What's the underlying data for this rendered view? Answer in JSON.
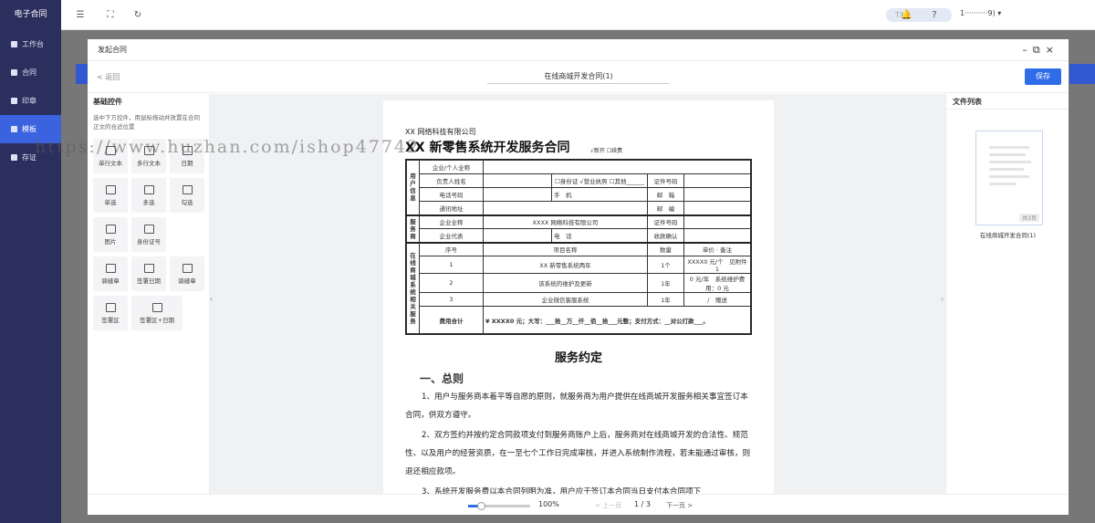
{
  "app": {
    "title": "电子合同"
  },
  "sidebar": {
    "items": [
      {
        "label": "工作台"
      },
      {
        "label": "合同"
      },
      {
        "label": "印章"
      },
      {
        "label": "模板"
      },
      {
        "label": "存证"
      }
    ]
  },
  "topbar": {
    "user_chip": "TX",
    "user_name": "1··········9)"
  },
  "modal": {
    "title": "发起合同",
    "back_label": "< 返回",
    "doc_title": "在线商城开发合同(1)",
    "save_label": "保存"
  },
  "left_panel": {
    "heading": "基础控件",
    "tip": "选中下方控件，用鼠标拖动并放置在合同正文的合适位置",
    "controls": [
      {
        "label": "单行文本"
      },
      {
        "label": "多行文本"
      },
      {
        "label": "日期"
      },
      {
        "label": "单选"
      },
      {
        "label": "多选"
      },
      {
        "label": "勾选"
      },
      {
        "label": "图片"
      },
      {
        "label": "身份证号"
      },
      {
        "label": "骑缝章"
      },
      {
        "label": "签署日期"
      },
      {
        "label": "骑缝章"
      },
      {
        "label": "签署区"
      },
      {
        "label": "签署区+日期"
      }
    ]
  },
  "document": {
    "company": "XX 网络科技有限公司",
    "title": "XX 新零售系统开发服务合同",
    "options": "√新开 ☐续费",
    "user_section": "用户信息",
    "user_rows": [
      [
        "企业/个人全称",
        "",
        "",
        ""
      ],
      [
        "负责人姓名",
        "☐身份证 √营业执照 ☐其他______",
        "证件号码",
        ""
      ],
      [
        "电话号码",
        "手　机",
        "邮　箱",
        ""
      ],
      [
        "通讯地址",
        "",
        "邮　编",
        ""
      ]
    ],
    "provider_section": "服务商",
    "provider_rows": [
      [
        "企业全称",
        "XXXX 网络科技有限公司",
        "证件号码",
        ""
      ],
      [
        "企业代表",
        "电　话",
        "收款确认",
        ""
      ]
    ],
    "service_section": "在线商城系统相关服务",
    "service_header": [
      "序号",
      "项目名称",
      "数量",
      "单价",
      "备注"
    ],
    "service_rows": [
      [
        "1",
        "XX 新零售系统两年",
        "1个",
        "XXXX0 元/个",
        "见附件 1"
      ],
      [
        "2",
        "该系统的维护及更新",
        "1年",
        "0 元/年",
        "系统维护费用：0 元"
      ],
      [
        "3",
        "企业微信客服系统",
        "1年",
        "/",
        "赠送"
      ]
    ],
    "total_label": "费用合计",
    "total_value": "¥ XXXX0 元；大写：___拾__万__仟__佰__拾___元整；支付方式：__对公打款___。",
    "section_title": "服务约定",
    "sub_title": "一、总则",
    "para1": "1、用户与服务商本着平等自愿的原则，就服务商为用户提供在线商城开发服务相关事宜签订本合同，供双方遵守。",
    "para2": "2、双方签约并按约定合同款项支付到服务商账户上后，服务商对在线商城开发的合法性、规范性、以及用户的经营资质，在一至七个工作日完成审核，并进入系统制作流程，若未能通过审核，则退还相应款项。",
    "para3": "3、系统开发服务费以本合同列明为准，用户应于签订本合同当日支付本合同项下"
  },
  "right_panel": {
    "heading": "文件列表",
    "thumb_badge": "共3页",
    "thumb_name": "在线商城开发合同(1)"
  },
  "footer": {
    "zoom": "100%",
    "zoom_fraction": 0.2,
    "prev": "< 上一页",
    "page": "1 / 3",
    "next": "下一页 >"
  },
  "watermark": "https://www.huzhan.com/ishop47742"
}
